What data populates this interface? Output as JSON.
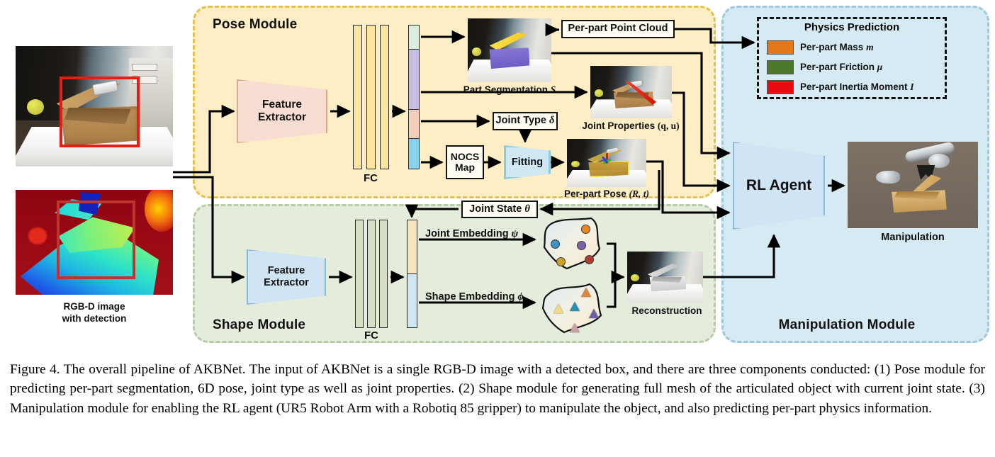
{
  "figure": {
    "caption": "Figure 4. The overall pipeline of AKBNet. The input of AKBNet is a single RGB-D image with a detected box, and there are three components conducted: (1) Pose module for predicting per-part segmentation, 6D pose, joint type as well as joint properties. (2) Shape module for generating full mesh of the articulated object with current joint state. (3) Manipulation module for enabling the RL agent (UR5 Robot Arm with a Robotiq 85 gripper) to manipulate the object, and also predicting per-part physics information."
  },
  "input": {
    "caption_line1": "RGB-D image",
    "caption_line2": "with detection",
    "rgb_image_name": "rgb-photo",
    "depth_image_name": "depth-map",
    "detection_box_color": "#e81b16"
  },
  "pose_module": {
    "title": "Pose Module",
    "bg_color": "#fdeec6",
    "border_color": "#e4c24a",
    "feature_extractor": {
      "line1": "Feature",
      "line2": "Extractor",
      "color": "#f8ded2"
    },
    "fc_label": "FC",
    "fc_bar_color": "#fbe5a0",
    "feature_vector_segments": [
      "#d8eddb",
      "#c6bee2",
      "#f4cdbb",
      "#87d1ed"
    ],
    "point_cloud_box": "Per-part Point Cloud",
    "part_segmentation_label": "Part Segmentation",
    "part_segmentation_symbol": "S",
    "joint_properties_label": "Joint Properties",
    "joint_properties_symbol": "(q, u)",
    "joint_type_label": "Joint Type",
    "joint_type_symbol": "δ",
    "nocs_line1": "NOCS",
    "nocs_line2": "Map",
    "fitting_label": "Fitting",
    "per_part_pose_label": "Per-part Pose",
    "per_part_pose_symbol": "(R, t)"
  },
  "shape_module": {
    "title": "Shape Module",
    "bg_color": "#e4ecdb",
    "border_color": "#b9cba6",
    "feature_extractor": {
      "line1": "Feature",
      "line2": "Extractor",
      "color": "#cfe4f4"
    },
    "fc_label": "FC",
    "fc_bar_color": "#d8e0c4",
    "feature_vector_segments": [
      "#f7e3bd",
      "#cfe6f3"
    ],
    "joint_state_label": "Joint State",
    "joint_state_symbol": "θ",
    "joint_embedding_label": "Joint Embedding",
    "joint_embedding_symbol": "ψ",
    "shape_embedding_label": "Shape Embedding",
    "shape_embedding_symbol": "ϕ",
    "reconstruction_label": "Reconstruction",
    "joint_embedding_points": [
      {
        "color": "#3d91c4",
        "x": 18,
        "y": 42
      },
      {
        "color": "#e8871f",
        "x": 62,
        "y": 16
      },
      {
        "color": "#7f62a8",
        "x": 56,
        "y": 45
      },
      {
        "color": "#c9a227",
        "x": 26,
        "y": 74
      },
      {
        "color": "#b03a36",
        "x": 68,
        "y": 70
      }
    ],
    "shape_embedding_points": [
      {
        "color": "#f5d98a",
        "x": 22,
        "y": 44
      },
      {
        "color": "#2f8fae",
        "x": 46,
        "y": 40
      },
      {
        "color": "#e0873a",
        "x": 62,
        "y": 14
      },
      {
        "color": "#6d5fa3",
        "x": 74,
        "y": 52
      },
      {
        "color": "#c9a0a5",
        "x": 46,
        "y": 78
      }
    ]
  },
  "manipulation_module": {
    "title": "Manipulation Module",
    "bg_color": "#d5eaf3",
    "border_color": "#9dc7dd",
    "rl_agent_label": "RL Agent",
    "manipulation_label": "Manipulation",
    "physics": {
      "title": "Physics Prediction",
      "rows": [
        {
          "color": "#e2771b",
          "label": "Per-part Mass",
          "symbol": "m"
        },
        {
          "color": "#4d7a2a",
          "label": "Per-part Friction",
          "symbol": "μ"
        },
        {
          "color": "#e90b12",
          "label": "Per-part Inertia Moment",
          "symbol": "I"
        }
      ]
    }
  }
}
